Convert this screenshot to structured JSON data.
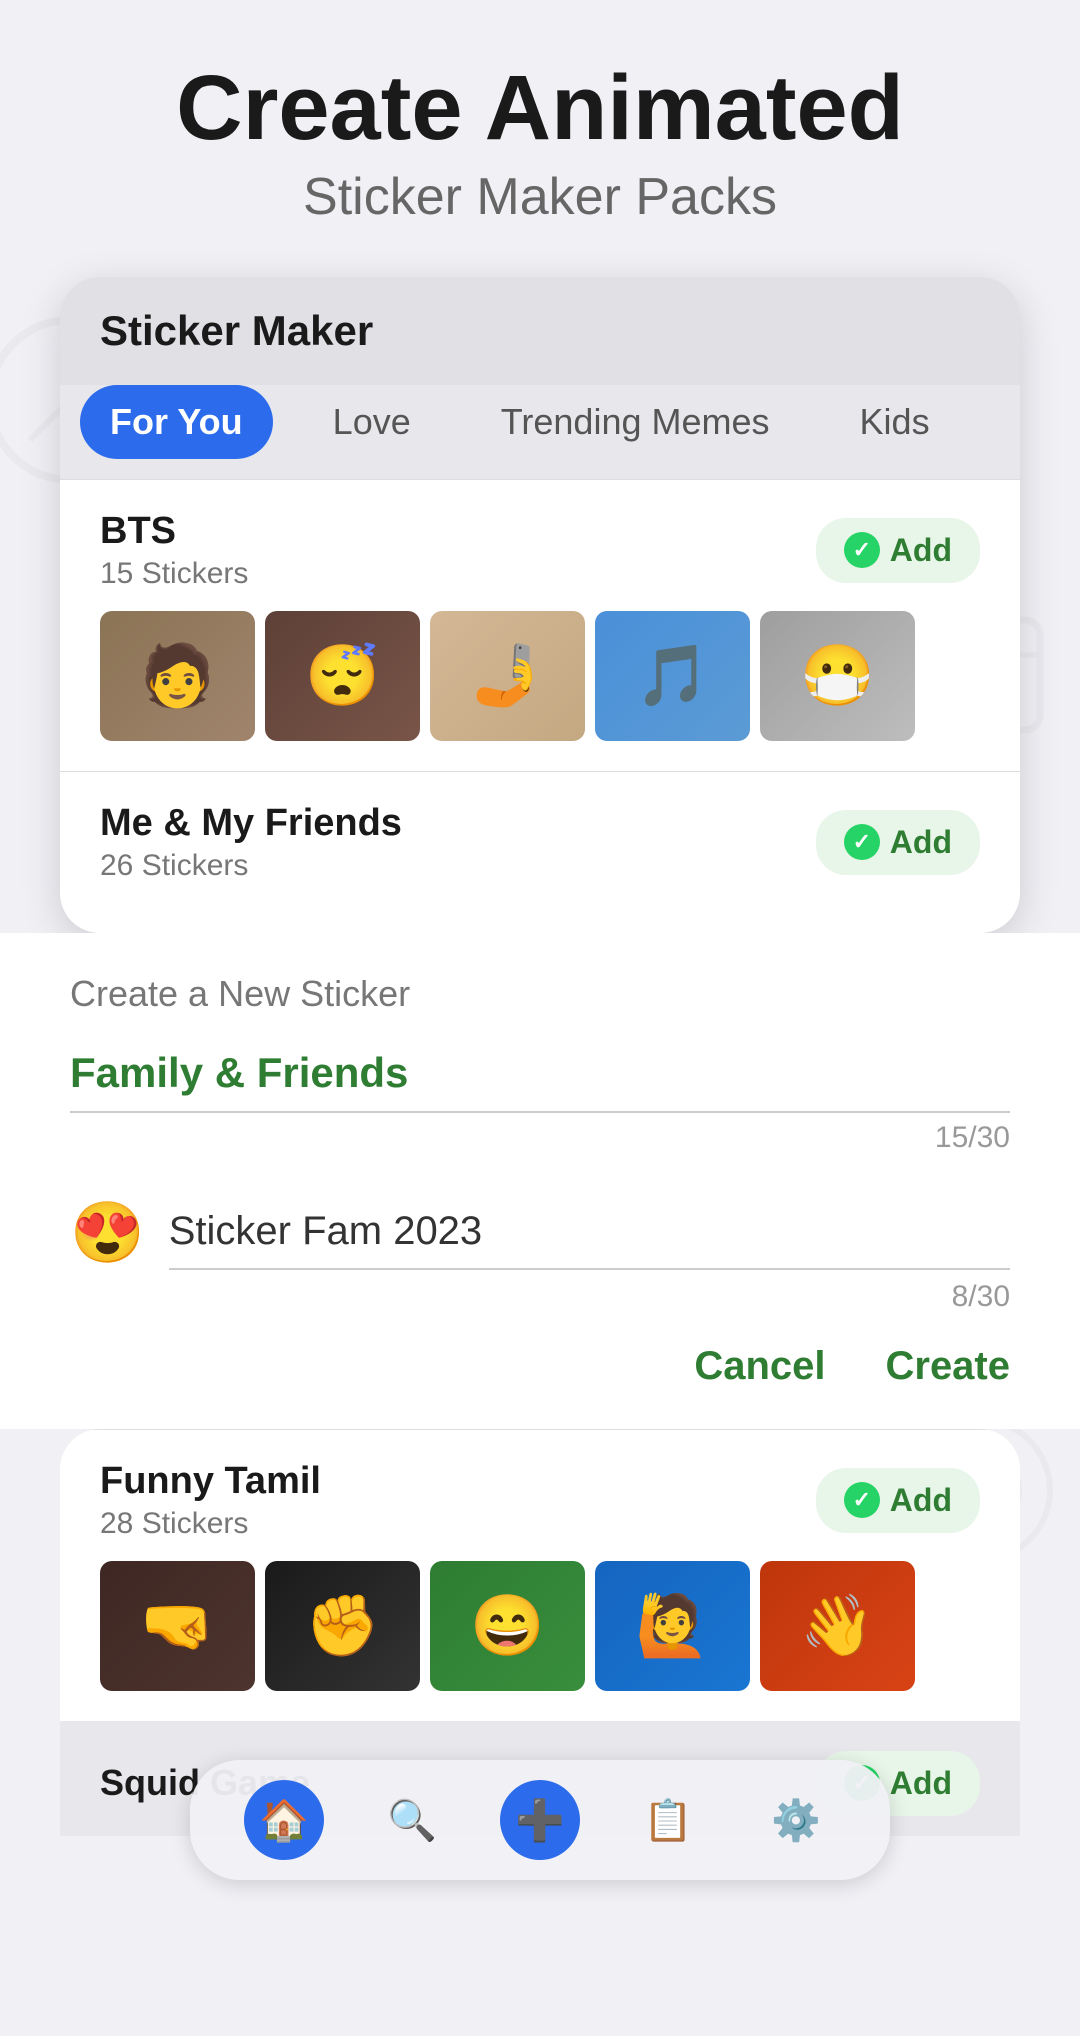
{
  "header": {
    "title": "Create Animated",
    "subtitle": "Sticker Maker Packs"
  },
  "phone_card": {
    "title": "Sticker Maker",
    "tabs": [
      {
        "label": "For You",
        "active": true
      },
      {
        "label": "Love",
        "active": false
      },
      {
        "label": "Trending Memes",
        "active": false
      },
      {
        "label": "Kids",
        "active": false
      }
    ],
    "packs": [
      {
        "name": "BTS",
        "count": "15 Stickers",
        "add_label": "Add"
      },
      {
        "name": "Me & My Friends",
        "count": "26 Stickers",
        "add_label": "Add"
      }
    ]
  },
  "popup": {
    "create_label": "Create a New Sticker",
    "field1": {
      "value": "Family & Friends",
      "counter": "15/30"
    },
    "field2": {
      "emoji": "😍",
      "value": "Sticker Fam 2023",
      "counter": "8/30"
    },
    "cancel_label": "Cancel",
    "create_label_btn": "Create"
  },
  "bottom_packs": [
    {
      "name": "Funny Tamil",
      "count": "28 Stickers",
      "add_label": "Add"
    },
    {
      "name": "Squid Game",
      "add_label": "Add"
    }
  ],
  "nav": {
    "items": [
      {
        "icon": "🏠",
        "label": "home",
        "active": true
      },
      {
        "icon": "🔍",
        "label": "search",
        "active": false
      },
      {
        "icon": "➕",
        "label": "add",
        "active": false
      },
      {
        "icon": "📋",
        "label": "packs",
        "active": false
      },
      {
        "icon": "⚙️",
        "label": "settings",
        "active": false
      }
    ]
  }
}
